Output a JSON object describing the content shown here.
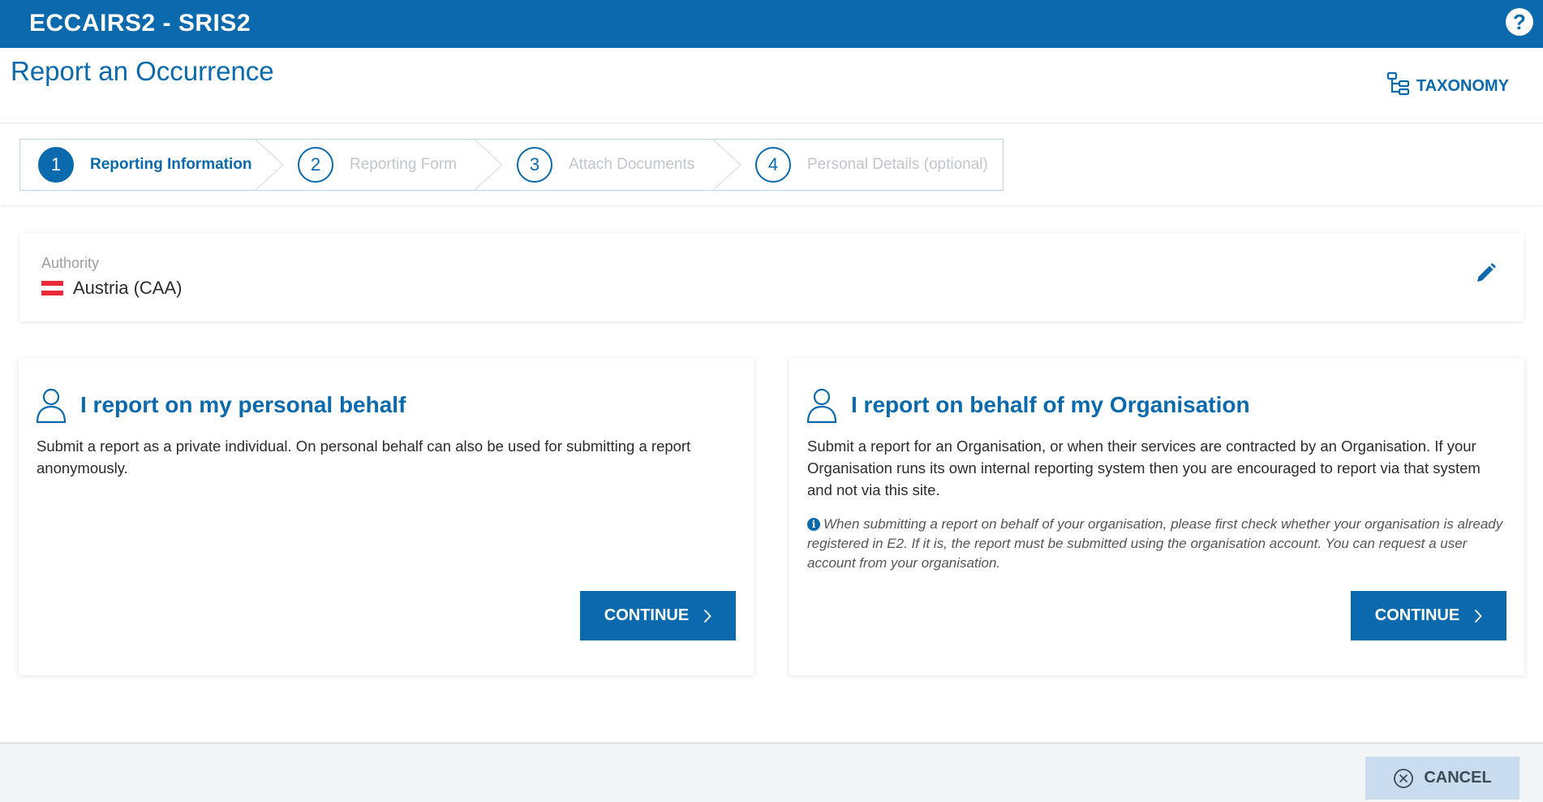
{
  "app": {
    "brand": "ECCAIRS2 - SRIS2",
    "help_label": "?"
  },
  "header": {
    "title": "Report an Occurrence",
    "taxonomy_label": "TAXONOMY"
  },
  "stepper": {
    "steps": [
      {
        "number": "1",
        "label": "Reporting Information",
        "active": true
      },
      {
        "number": "2",
        "label": "Reporting Form",
        "active": false
      },
      {
        "number": "3",
        "label": "Attach Documents",
        "active": false
      },
      {
        "number": "4",
        "label": "Personal Details (optional)",
        "active": false
      }
    ]
  },
  "authority": {
    "label": "Authority",
    "value": "Austria (CAA)",
    "flag_colors": [
      "#ed2939",
      "#ffffff",
      "#ed2939"
    ]
  },
  "cards": {
    "personal": {
      "icon": "user-icon",
      "title": "I report on my personal behalf",
      "text": "Submit a report as a private individual. On personal behalf can also be used for submitting a report anonymously.",
      "button_label": "CONTINUE"
    },
    "organisation": {
      "icon": "user-icon",
      "title": "I report on behalf of my Organisation",
      "text": "Submit a report for an Organisation, or when their services are contracted by an Organisation. If your Organisation runs its own internal reporting system then you are encouraged to report via that system and not via this site.",
      "info": "When submitting a report on behalf of your organisation, please first check whether your organisation is already registered in E2. If it is, the report must be submitted using the organisation account. You can request a user account from your organisation.",
      "button_label": "CONTINUE"
    }
  },
  "footer": {
    "cancel_label": "CANCEL"
  },
  "colors": {
    "primary": "#0a6aad",
    "cancel_bg": "#c9ddef",
    "inactive_step": "#c0c6cb"
  }
}
